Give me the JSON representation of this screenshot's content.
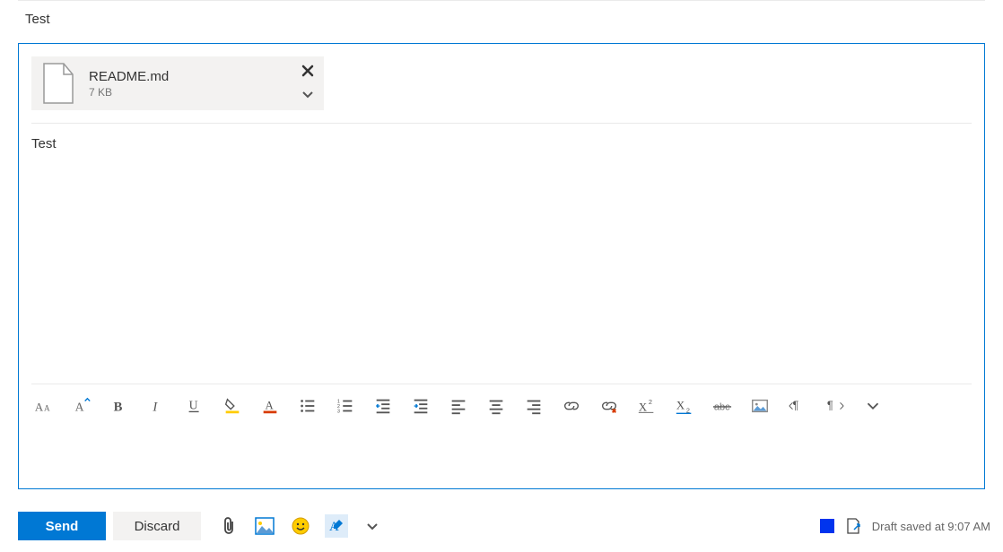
{
  "subject": "Test",
  "attachment": {
    "name": "README.md",
    "size": "7 KB"
  },
  "body": "Test",
  "actions": {
    "send": "Send",
    "discard": "Discard"
  },
  "status": {
    "text": "Draft saved at 9:07 AM"
  }
}
